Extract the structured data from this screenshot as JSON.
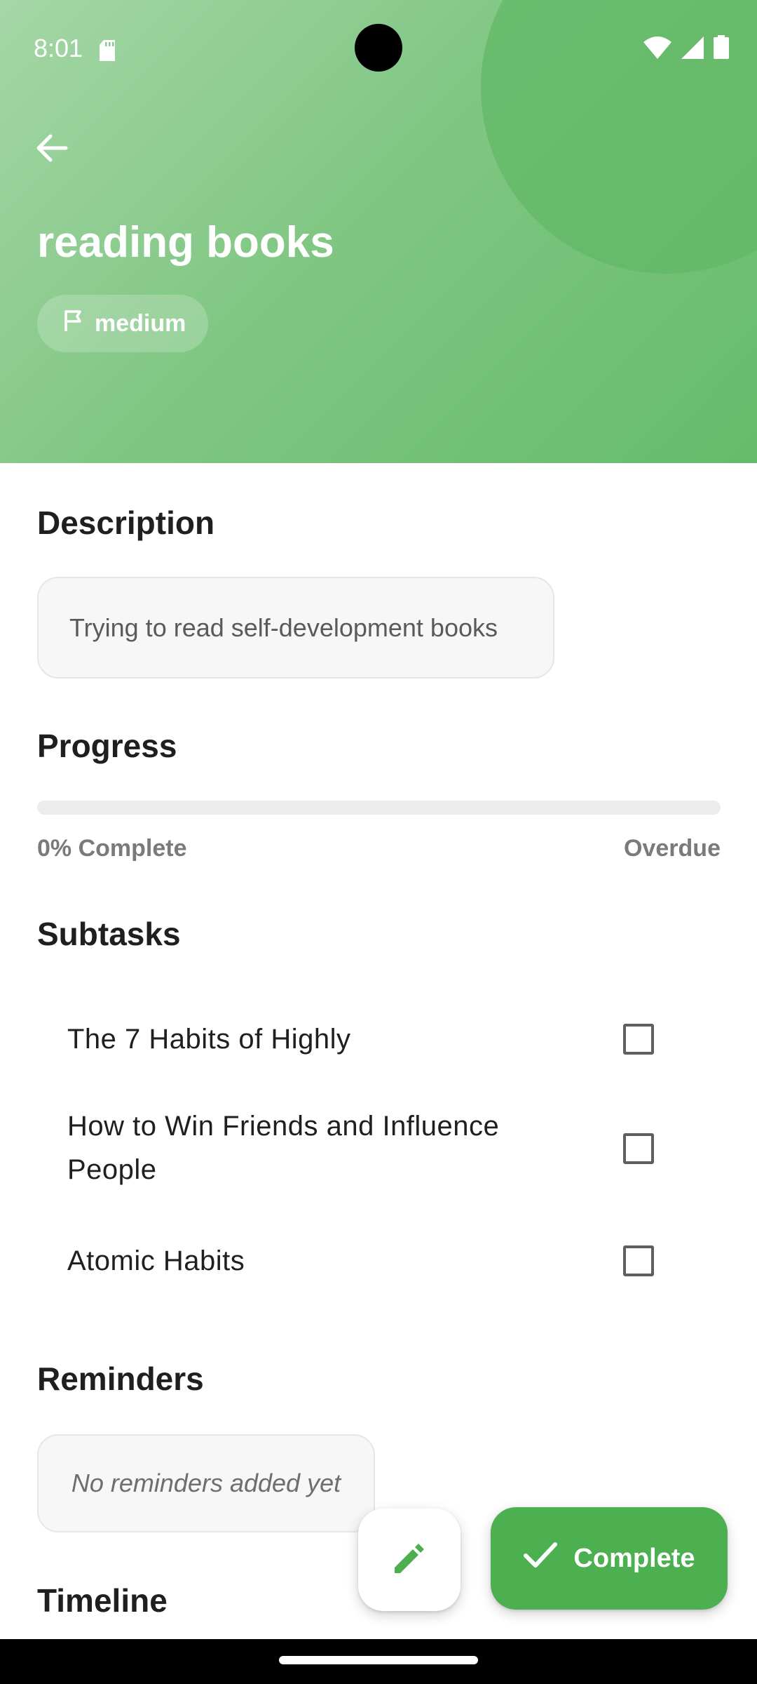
{
  "status_bar": {
    "time": "8:01"
  },
  "task": {
    "title": "reading books",
    "priority": "medium"
  },
  "description": {
    "heading": "Description",
    "text": "Trying to read self-development books"
  },
  "progress": {
    "heading": "Progress",
    "percent_value": 0,
    "percent_label": "0% Complete",
    "status": "Overdue"
  },
  "subtasks": {
    "heading": "Subtasks",
    "items": [
      {
        "label": "The 7 Habits of Highly",
        "checked": false
      },
      {
        "label": "How to Win Friends and Influence People",
        "checked": false
      },
      {
        "label": "Atomic Habits",
        "checked": false
      }
    ]
  },
  "reminders": {
    "heading": "Reminders",
    "empty_text": "No reminders added yet"
  },
  "timeline": {
    "heading": "Timeline"
  },
  "actions": {
    "complete_label": "Complete"
  },
  "colors": {
    "accent": "#4caf50",
    "header_start": "#a5d6a7",
    "header_end": "#66bb6a"
  },
  "icons": {
    "back": "arrow-left-icon",
    "priority": "flag-icon",
    "edit": "pencil-icon",
    "complete": "check-icon"
  }
}
